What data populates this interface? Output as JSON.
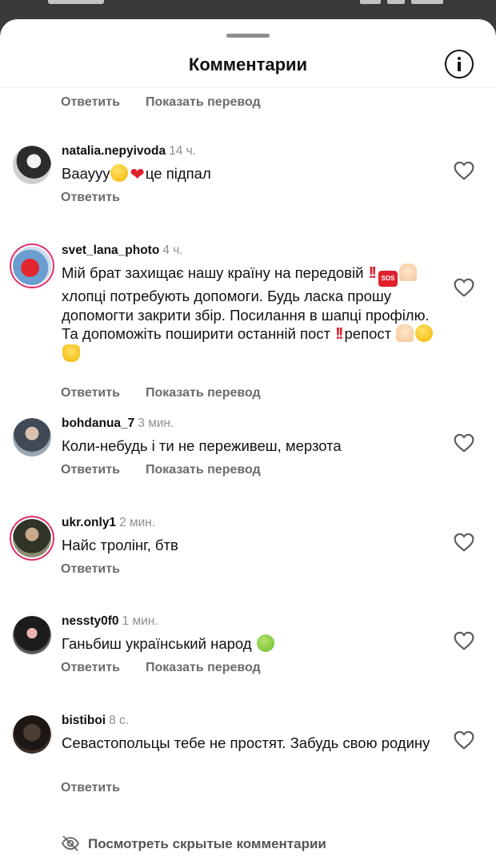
{
  "header": {
    "title": "Комментарии"
  },
  "top_actions": {
    "reply": "Ответить",
    "translate": "Показать перевод"
  },
  "comments": [
    {
      "username": "natalia.nepyivoda",
      "time": "14 ч.",
      "text_parts": [
        "Ваауyy",
        "це підпал"
      ],
      "reply": "Ответить"
    },
    {
      "username": "svet_lana_photo",
      "time": "4 ч.",
      "text_parts": [
        "Мій брат захищає нашу країну на передовій",
        "хлопці потребують допомоги. Будь ласка прошу допомогти закрити збір. Посилання в шапці профілю. Та допоможіть поширити  останній пост",
        "репост"
      ],
      "reply": "Ответить",
      "translate": "Показать перевод"
    },
    {
      "username": "bohdanua_7",
      "time": "3 мин.",
      "text": "Коли-небудь і ти не переживеш, мерзота",
      "reply": "Ответить",
      "translate": "Показать перевод"
    },
    {
      "username": "ukr.only1",
      "time": "2 мин.",
      "text": "Найс тролінг, бтв",
      "reply": "Ответить"
    },
    {
      "username": "nessty0f0",
      "time": "1 мин.",
      "text": "Ганьбиш український народ",
      "reply": "Ответить",
      "translate": "Показать перевод"
    },
    {
      "username": "bistiboi",
      "time": "8 с.",
      "text": "Севастопольцы тебе не простят. Забудь свою родину",
      "reply": "Ответить"
    }
  ],
  "footer": {
    "hidden_comments": "Посмотреть скрытые комментарии"
  },
  "icons": [
    "info-icon",
    "heart-icon",
    "eye-off-icon"
  ],
  "colors": {
    "secondary_text": "#6b6b6b",
    "story_ring": "#e1306c",
    "sheet_bg": "#ffffff"
  }
}
